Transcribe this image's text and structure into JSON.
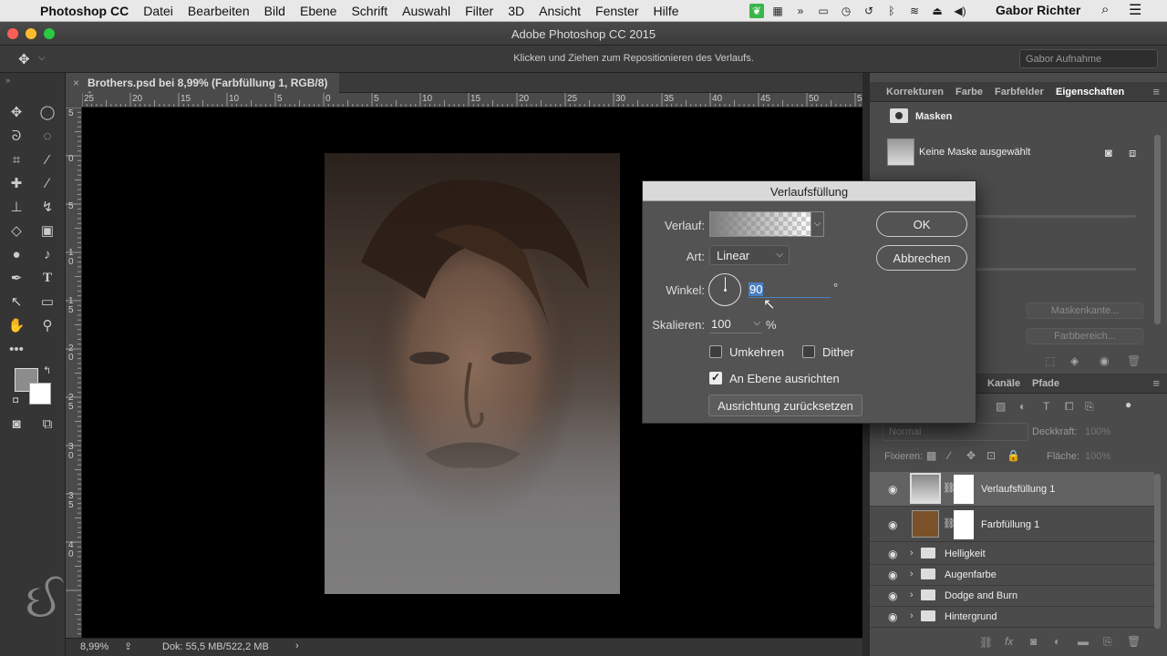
{
  "menubar": {
    "app": "Photoshop CC",
    "items": [
      "Datei",
      "Bearbeiten",
      "Bild",
      "Ebene",
      "Schrift",
      "Auswahl",
      "Filter",
      "3D",
      "Ansicht",
      "Fenster",
      "Hilfe"
    ],
    "user": "Gabor Richter"
  },
  "window": {
    "title": "Adobe Photoshop CC 2015"
  },
  "options": {
    "hint": "Klicken und Ziehen zum Repositionieren des Verlaufs.",
    "workspace": "Gabor Aufnahme"
  },
  "document": {
    "tab": "Brothers.psd bei 8,99% (Farbfüllung 1, RGB/8) *",
    "ruler_h": [
      "25",
      "20",
      "15",
      "10",
      "5",
      "0",
      "5",
      "10",
      "15",
      "20",
      "25",
      "30",
      "35",
      "40",
      "45",
      "50",
      "5"
    ],
    "ruler_v": [
      "5",
      "0",
      "5",
      "1 0",
      "1 5",
      "2 0",
      "2 5",
      "3 0",
      "3 5",
      "4 0"
    ]
  },
  "status": {
    "zoom": "8,99%",
    "doc": "Dok: 55,5 MB/522,2 MB"
  },
  "panel_top": {
    "tabs": [
      "Korrekturen",
      "Farbe",
      "Farbfelder",
      "Eigenschaften"
    ],
    "section": "Masken",
    "mask": "Keine Maske ausgewählt",
    "btn_edge": "Maskenkante...",
    "btn_color": "Farbbereich..."
  },
  "layers": {
    "tabs": [
      "Kanäle",
      "Pfade"
    ],
    "blend": "Normal",
    "opacity_label": "Deckkraft:",
    "opacity": "100%",
    "lock_label": "Fixieren:",
    "fill_label": "Fläche:",
    "fill": "100%",
    "items": [
      {
        "name": "Verlaufsfüllung 1"
      },
      {
        "name": "Farbfüllung 1"
      },
      {
        "name": "Helligkeit"
      },
      {
        "name": "Augenfarbe"
      },
      {
        "name": "Dodge and Burn"
      },
      {
        "name": "Hintergrund"
      }
    ]
  },
  "dialog": {
    "title": "Verlaufsfüllung",
    "gradient_label": "Verlauf:",
    "style_label": "Art:",
    "style": "Linear",
    "angle_label": "Winkel:",
    "angle": "90",
    "degree": "°",
    "scale_label": "Skalieren:",
    "scale": "100",
    "percent": "%",
    "reverse": "Umkehren",
    "dither": "Dither",
    "align": "An Ebene ausrichten",
    "align_checked": true,
    "reset": "Ausrichtung zurücksetzen",
    "ok": "OK",
    "cancel": "Abbrechen"
  },
  "colors": {
    "accent": "#4a7fc1",
    "mask_brown": "#7a5129"
  }
}
